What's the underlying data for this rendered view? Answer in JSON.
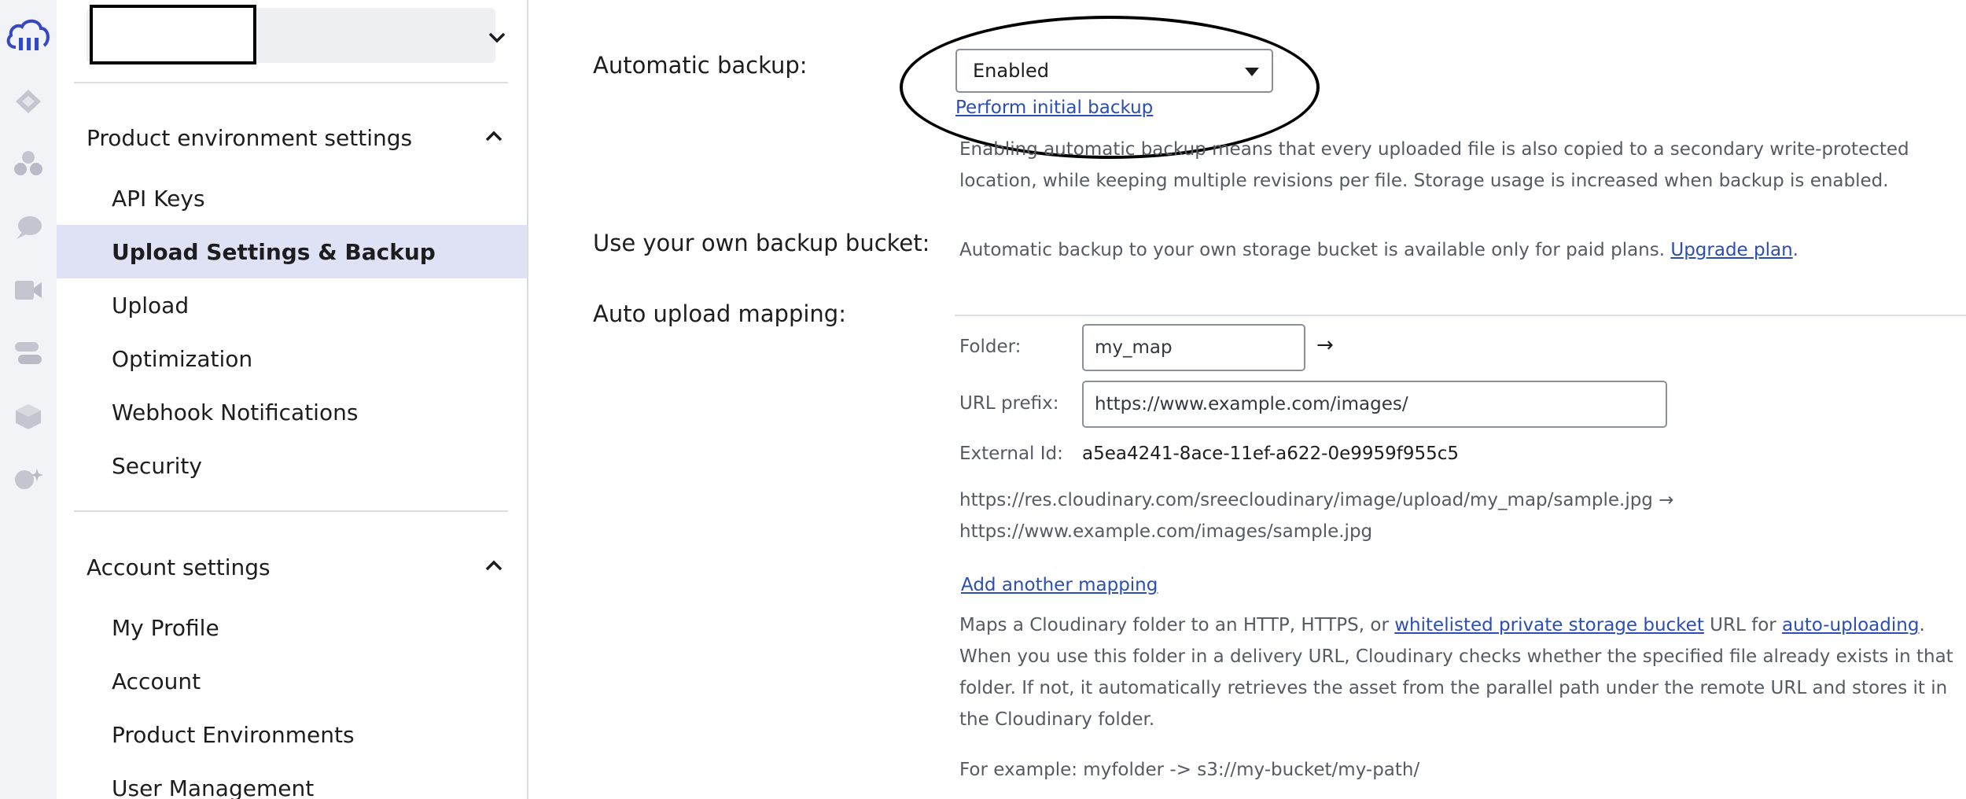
{
  "rail": {
    "icons": [
      "cloudinary-logo-icon",
      "media-library-icon",
      "assets-icon",
      "chat-bubble-icon",
      "video-icon",
      "integrations-icon",
      "cube-icon",
      "ai-sparkle-icon"
    ]
  },
  "sidebar": {
    "product_section_title": "Product environment settings",
    "product_items": [
      {
        "label": "API Keys",
        "active": false
      },
      {
        "label": "Upload Settings & Backup",
        "active": true
      },
      {
        "label": "Upload",
        "active": false
      },
      {
        "label": "Optimization",
        "active": false
      },
      {
        "label": "Webhook Notifications",
        "active": false
      },
      {
        "label": "Security",
        "active": false
      }
    ],
    "account_section_title": "Account settings",
    "account_items": [
      {
        "label": "My Profile"
      },
      {
        "label": "Account"
      },
      {
        "label": "Product Environments"
      },
      {
        "label": "User Management"
      }
    ]
  },
  "main": {
    "automatic_backup": {
      "label": "Automatic backup:",
      "selected": "Enabled",
      "initial_backup_link": "Perform initial backup",
      "help_line1": "Enabling automatic backup means that every uploaded file is also copied to a secondary write-protected",
      "help_line2": "location, while keeping multiple revisions per file. Storage usage is increased when backup is enabled."
    },
    "own_bucket": {
      "label": "Use your own backup bucket:",
      "text": "Automatic backup to your own storage bucket is available only for paid plans. ",
      "upgrade_link": "Upgrade plan",
      "period": "."
    },
    "mapping": {
      "label": "Auto upload mapping:",
      "folder_label": "Folder:",
      "folder_value": "my_map",
      "arrow": "→",
      "url_prefix_label": "URL prefix:",
      "url_prefix_value": "https://www.example.com/images/",
      "external_id_label": "External Id:",
      "external_id_value": "a5ea4241-8ace-11ef-a622-0e9959f955c5",
      "example_line1": "https://res.cloudinary.com/sreecloudinary/image/upload/my_map/sample.jpg →",
      "example_line2": "https://www.example.com/images/sample.jpg",
      "add_link": "Add another mapping",
      "desc_part1": "Maps a Cloudinary folder to an HTTP, HTTPS, or ",
      "desc_link1": "whitelisted private storage bucket",
      "desc_part2": " URL for ",
      "desc_link2": "auto-uploading",
      "desc_part3": ".",
      "desc_line2": "When you use this folder in a delivery URL, Cloudinary checks whether the specified file already exists in that",
      "desc_line3": "folder. If not, it automatically retrieves the asset from the parallel path under the remote URL and stores it in",
      "desc_line4": "the Cloudinary folder.",
      "example_footer": "For example: myfolder -> s3://my-bucket/my-path/"
    }
  },
  "colors": {
    "accent": "#3448c5",
    "link": "#2b4eb4",
    "active_bg": "#dfe2f5",
    "rail_icon": "#b9bcc6"
  }
}
